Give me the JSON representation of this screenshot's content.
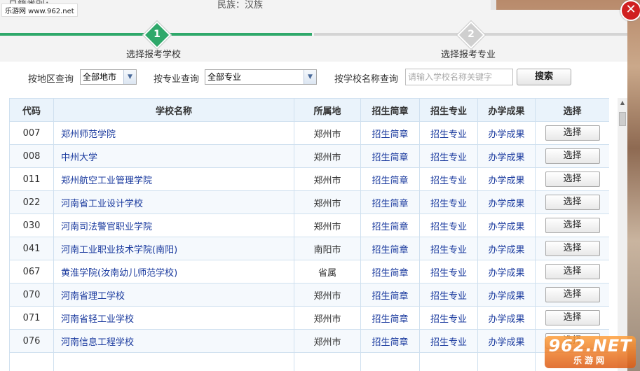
{
  "background": {
    "site_logo": "乐游网 www.962.net",
    "text_left": "日籍类别：",
    "text_mid": "民族：汉族"
  },
  "watermark": {
    "logo": "962.NET",
    "sub": "乐游网"
  },
  "modal": {
    "close_icon": "close-icon",
    "steps": [
      {
        "number": "1",
        "label": "选择报考学校",
        "active": true
      },
      {
        "number": "2",
        "label": "选择报考专业",
        "active": false
      }
    ],
    "filters": {
      "region_label": "按地区查询",
      "region_value": "全部地市",
      "major_label": "按专业查询",
      "major_value": "全部专业",
      "name_label": "按学校名称查询",
      "name_placeholder": "请输入学校名称关键字",
      "search_button": "搜索"
    },
    "table": {
      "headers": [
        "代码",
        "学校名称",
        "所属地",
        "招生简章",
        "招生专业",
        "办学成果",
        "选择"
      ],
      "rows": [
        {
          "code": "007",
          "name": "郑州师范学院",
          "location": "郑州市",
          "brochure": "招生简章",
          "majors": "招生专业",
          "results": "办学成果",
          "select": "选择"
        },
        {
          "code": "008",
          "name": "中州大学",
          "location": "郑州市",
          "brochure": "招生简章",
          "majors": "招生专业",
          "results": "办学成果",
          "select": "选择"
        },
        {
          "code": "011",
          "name": "郑州航空工业管理学院",
          "location": "郑州市",
          "brochure": "招生简章",
          "majors": "招生专业",
          "results": "办学成果",
          "select": "选择"
        },
        {
          "code": "022",
          "name": "河南省工业设计学校",
          "location": "郑州市",
          "brochure": "招生简章",
          "majors": "招生专业",
          "results": "办学成果",
          "select": "选择"
        },
        {
          "code": "030",
          "name": "河南司法警官职业学院",
          "location": "郑州市",
          "brochure": "招生简章",
          "majors": "招生专业",
          "results": "办学成果",
          "select": "选择"
        },
        {
          "code": "041",
          "name": "河南工业职业技术学院(南阳)",
          "location": "南阳市",
          "brochure": "招生简章",
          "majors": "招生专业",
          "results": "办学成果",
          "select": "选择"
        },
        {
          "code": "067",
          "name": "黄淮学院(汝南幼儿师范学校)",
          "location": "省属",
          "brochure": "招生简章",
          "majors": "招生专业",
          "results": "办学成果",
          "select": "选择"
        },
        {
          "code": "070",
          "name": "河南省理工学校",
          "location": "郑州市",
          "brochure": "招生简章",
          "majors": "招生专业",
          "results": "办学成果",
          "select": "选择"
        },
        {
          "code": "071",
          "name": "河南省轻工业学校",
          "location": "郑州市",
          "brochure": "招生简章",
          "majors": "招生专业",
          "results": "办学成果",
          "select": "选择"
        },
        {
          "code": "076",
          "name": "河南信息工程学校",
          "location": "郑州市",
          "brochure": "招生简章",
          "majors": "招生专业",
          "results": "办学成果",
          "select": "选择"
        },
        {
          "code": "",
          "name": "",
          "location": "",
          "brochure": "",
          "majors": "",
          "results": "",
          "select": ""
        }
      ]
    }
  },
  "colors": {
    "accent": "#2ea86a",
    "link": "#1a3a9e",
    "close": "#d02020",
    "header_bg": "#eaf3fb"
  }
}
